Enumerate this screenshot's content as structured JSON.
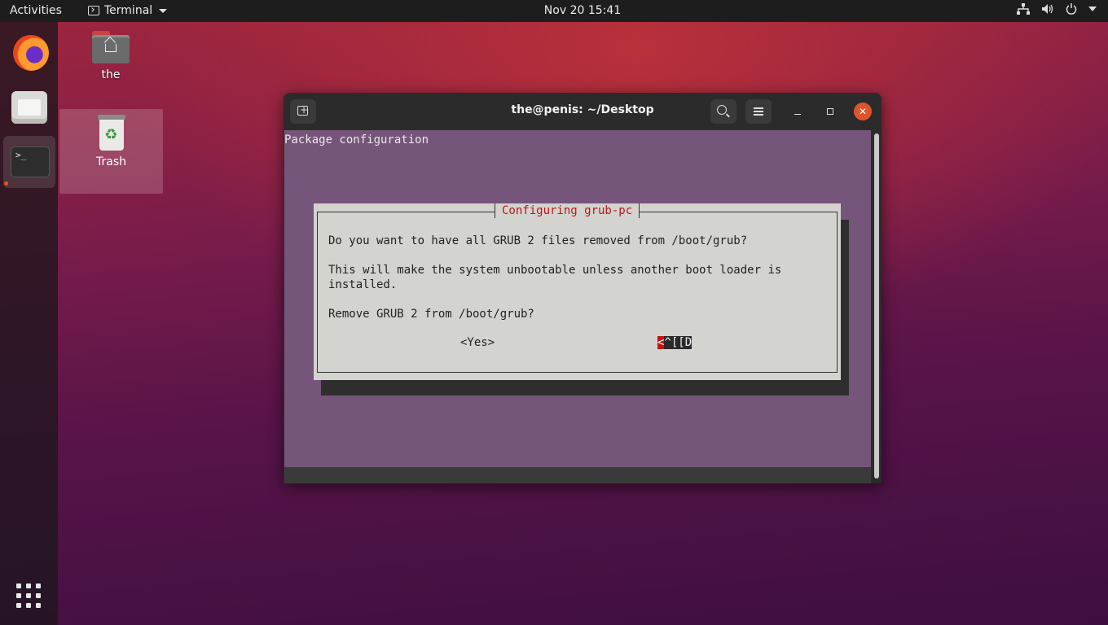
{
  "topbar": {
    "activities": "Activities",
    "app_name": "Terminal",
    "clock": "Nov 20  15:41",
    "tray_icons": [
      "network-icon",
      "volume-icon",
      "power-icon",
      "chevron-down-icon"
    ]
  },
  "dock": {
    "items": [
      "firefox-icon",
      "files-icon",
      "terminal-icon"
    ],
    "active": "terminal-icon",
    "apps_button": "show-applications-icon"
  },
  "desktop": {
    "home_label": "the",
    "trash_label": "Trash"
  },
  "window": {
    "title": "the@penis: ~/Desktop"
  },
  "terminal": {
    "header": "Package configuration",
    "dialog": {
      "title": "Configuring grub-pc",
      "line1": "Do you want to have all GRUB 2 files removed from /boot/grub?",
      "line2": "This will make the system unbootable unless another boot loader is",
      "line3": "installed.",
      "line4": "Remove GRUB 2 from /boot/grub?",
      "yes": "<Yes>",
      "no_first": "<",
      "no_rest": "^[[D"
    }
  },
  "colors": {
    "terminal_bg": "#76557a",
    "dialog_bg": "#d3d3cf",
    "dialog_title": "#c21414",
    "close_button": "#e0542c",
    "accent": "#e95420"
  }
}
